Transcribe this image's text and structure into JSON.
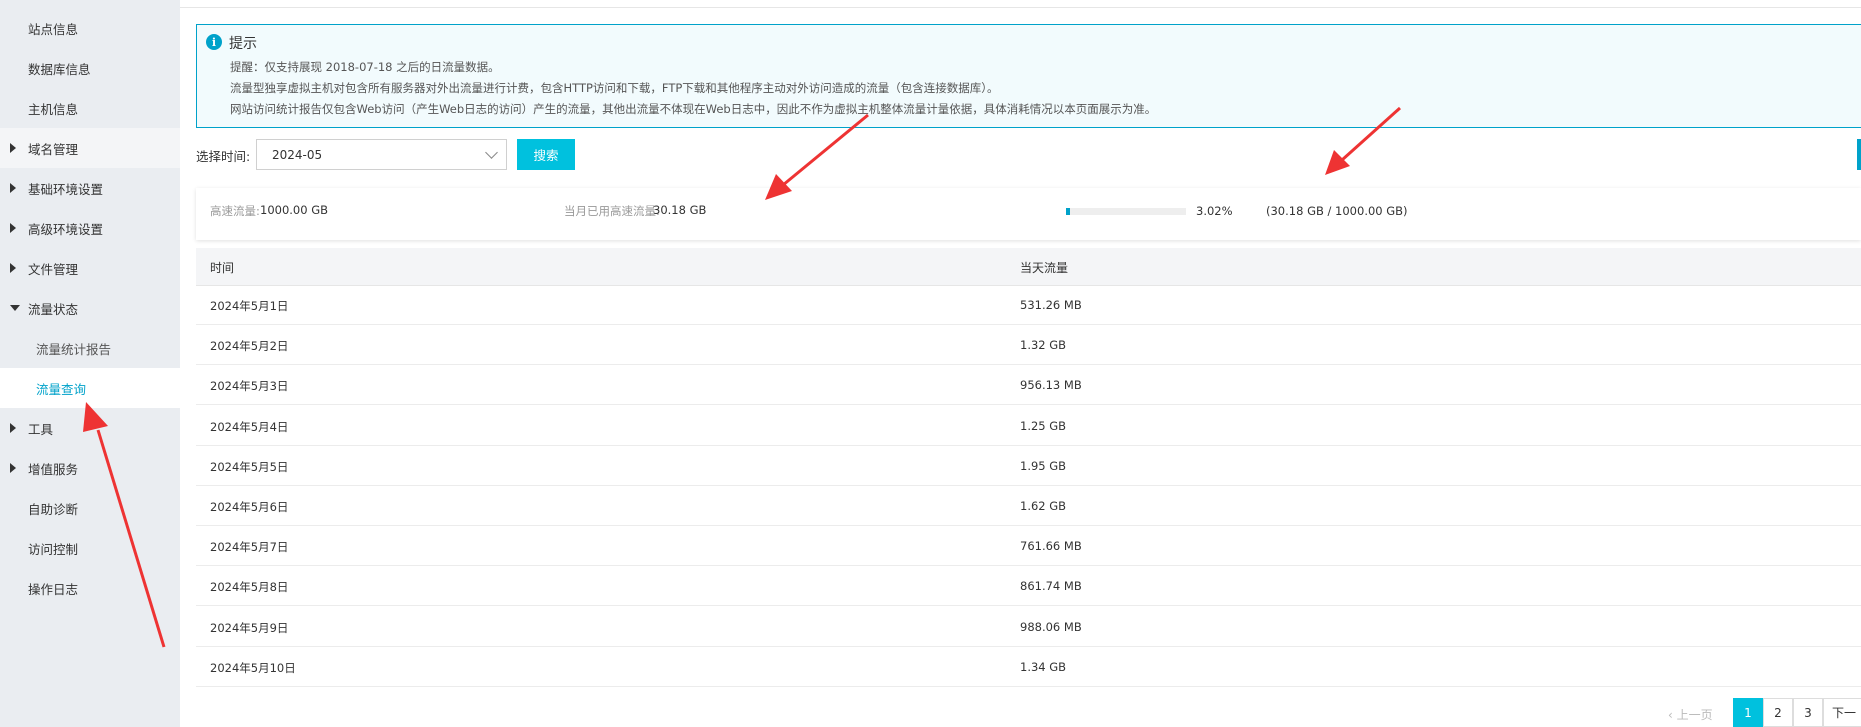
{
  "sidebar": {
    "items": [
      {
        "label": "站点信息"
      },
      {
        "label": "数据库信息"
      },
      {
        "label": "主机信息"
      },
      {
        "label": "域名管理"
      },
      {
        "label": "基础环境设置"
      },
      {
        "label": "高级环境设置"
      },
      {
        "label": "文件管理"
      },
      {
        "label": "流量状态"
      },
      {
        "label": "流量统计报告"
      },
      {
        "label": "流量查询"
      },
      {
        "label": "工具"
      },
      {
        "label": "增值服务"
      },
      {
        "label": "自助诊断"
      },
      {
        "label": "访问控制"
      },
      {
        "label": "操作日志"
      }
    ]
  },
  "notice": {
    "icon": "info-icon",
    "title": "提示",
    "lines": [
      "提醒：仅支持展现 2018-07-18 之后的日流量数据。",
      "流量型独享虚拟主机对包含所有服务器对外出流量进行计费，包含HTTP访问和下载，FTP下载和其他程序主动对外访问造成的流量（包含连接数据库）。",
      "网站访问统计报告仅包含Web访问（产生Web日志的访问）产生的流量，其他出流量不体现在Web日志中，因此不作为虚拟主机整体流量计量依据，具体消耗情况以本页面展示为准。"
    ]
  },
  "filter": {
    "label": "选择时间:",
    "value": "2024-05",
    "search_label": "搜索"
  },
  "summary": {
    "high_speed_label": "高速流量:",
    "high_speed_value": "1000.00 GB",
    "used_label": "当月已用高速流量:",
    "used_value": "30.18 GB",
    "progress_fraction": 0.0302,
    "percent_text": "3.02%",
    "ratio_text": "(30.18 GB / 1000.00 GB)"
  },
  "table": {
    "headers": [
      "时间",
      "当天流量"
    ],
    "rows": [
      {
        "date": "2024年5月1日",
        "flow": "531.26 MB"
      },
      {
        "date": "2024年5月2日",
        "flow": "1.32 GB"
      },
      {
        "date": "2024年5月3日",
        "flow": "956.13 MB"
      },
      {
        "date": "2024年5月4日",
        "flow": "1.25 GB"
      },
      {
        "date": "2024年5月5日",
        "flow": "1.95 GB"
      },
      {
        "date": "2024年5月6日",
        "flow": "1.62 GB"
      },
      {
        "date": "2024年5月7日",
        "flow": "761.66 MB"
      },
      {
        "date": "2024年5月8日",
        "flow": "861.74 MB"
      },
      {
        "date": "2024年5月9日",
        "flow": "988.06 MB"
      },
      {
        "date": "2024年5月10日",
        "flow": "1.34 GB"
      }
    ]
  },
  "pagination": {
    "prev_label": "上一页",
    "pages": [
      "1",
      "2",
      "3"
    ],
    "next_label": "下一"
  },
  "colors": {
    "accent": "#00a2ca",
    "button": "#00c1de",
    "arrow": "#ee3333"
  }
}
